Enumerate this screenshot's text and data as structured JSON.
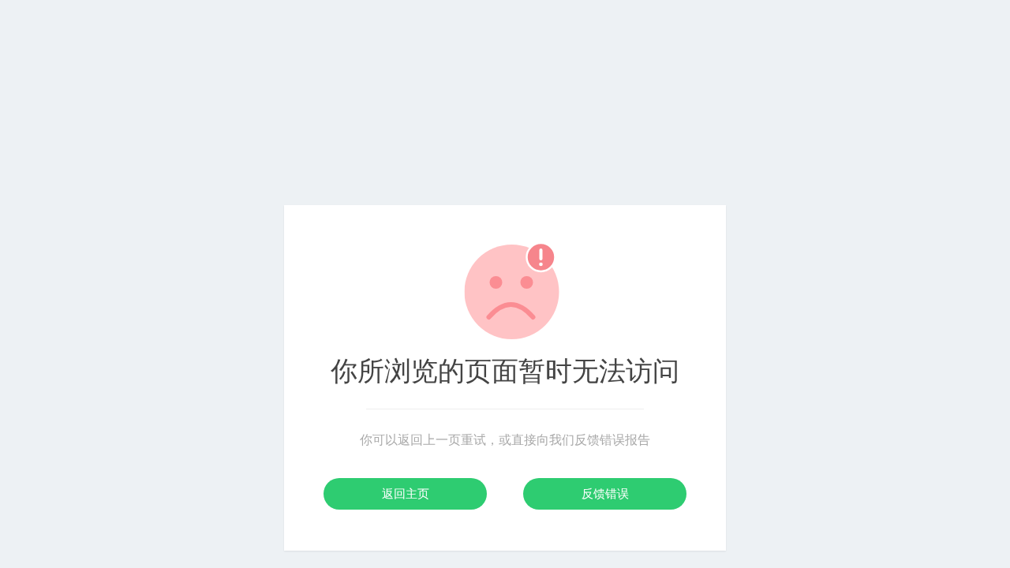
{
  "error": {
    "title": "你所浏览的页面暂时无法访问",
    "message": "你可以返回上一页重试，或直接向我们反馈错误报告",
    "buttons": [
      {
        "label": "返回主页"
      },
      {
        "label": "反馈错误"
      }
    ]
  }
}
